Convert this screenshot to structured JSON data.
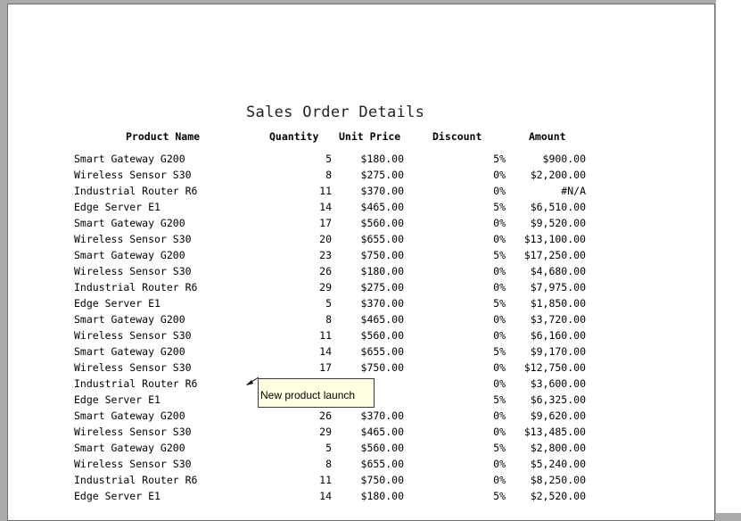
{
  "report": {
    "title": "Sales Order Details",
    "headers": {
      "product_name": "Product Name",
      "quantity": "Quantity",
      "unit_price": "Unit Price",
      "discount": "Discount",
      "amount": "Amount"
    },
    "rows": [
      {
        "product": "Smart Gateway G200",
        "qty": "5",
        "price": "$180.00",
        "discount": "5%",
        "amount": "$900.00"
      },
      {
        "product": "Wireless Sensor S30",
        "qty": "8",
        "price": "$275.00",
        "discount": "0%",
        "amount": "$2,200.00"
      },
      {
        "product": "Industrial Router R6",
        "qty": "11",
        "price": "$370.00",
        "discount": "0%",
        "amount": "#N/A"
      },
      {
        "product": "Edge Server E1",
        "qty": "14",
        "price": "$465.00",
        "discount": "5%",
        "amount": "$6,510.00"
      },
      {
        "product": "Smart Gateway G200",
        "qty": "17",
        "price": "$560.00",
        "discount": "0%",
        "amount": "$9,520.00"
      },
      {
        "product": "Wireless Sensor S30",
        "qty": "20",
        "price": "$655.00",
        "discount": "0%",
        "amount": "$13,100.00"
      },
      {
        "product": "Smart Gateway G200",
        "qty": "23",
        "price": "$750.00",
        "discount": "5%",
        "amount": "$17,250.00"
      },
      {
        "product": "Wireless Sensor S30",
        "qty": "26",
        "price": "$180.00",
        "discount": "0%",
        "amount": "$4,680.00"
      },
      {
        "product": "Industrial Router R6",
        "qty": "29",
        "price": "$275.00",
        "discount": "0%",
        "amount": "$7,975.00"
      },
      {
        "product": "Edge Server E1",
        "qty": "5",
        "price": "$370.00",
        "discount": "5%",
        "amount": "$1,850.00"
      },
      {
        "product": "Smart Gateway G200",
        "qty": "8",
        "price": "$465.00",
        "discount": "0%",
        "amount": "$3,720.00"
      },
      {
        "product": "Wireless Sensor S30",
        "qty": "11",
        "price": "$560.00",
        "discount": "0%",
        "amount": "$6,160.00"
      },
      {
        "product": "Smart Gateway G200",
        "qty": "14",
        "price": "$655.00",
        "discount": "5%",
        "amount": "$9,170.00"
      },
      {
        "product": "Wireless Sensor S30",
        "qty": "17",
        "price": "$750.00",
        "discount": "0%",
        "amount": "$12,750.00"
      },
      {
        "product": "Industrial Router R6",
        "qty": "",
        "price": "",
        "discount": "0%",
        "amount": "$3,600.00"
      },
      {
        "product": "Edge Server E1",
        "qty": "",
        "price": "",
        "discount": "5%",
        "amount": "$6,325.00"
      },
      {
        "product": "Smart Gateway G200",
        "qty": "26",
        "price": "$370.00",
        "discount": "0%",
        "amount": "$9,620.00"
      },
      {
        "product": "Wireless Sensor S30",
        "qty": "29",
        "price": "$465.00",
        "discount": "0%",
        "amount": "$13,485.00"
      },
      {
        "product": "Smart Gateway G200",
        "qty": "5",
        "price": "$560.00",
        "discount": "5%",
        "amount": "$2,800.00"
      },
      {
        "product": "Wireless Sensor S30",
        "qty": "8",
        "price": "$655.00",
        "discount": "0%",
        "amount": "$5,240.00"
      },
      {
        "product": "Industrial Router R6",
        "qty": "11",
        "price": "$750.00",
        "discount": "0%",
        "amount": "$8,250.00"
      },
      {
        "product": "Edge Server E1",
        "qty": "14",
        "price": "$180.00",
        "discount": "5%",
        "amount": "$2,520.00"
      }
    ],
    "comment": {
      "text": "New product launch"
    }
  }
}
